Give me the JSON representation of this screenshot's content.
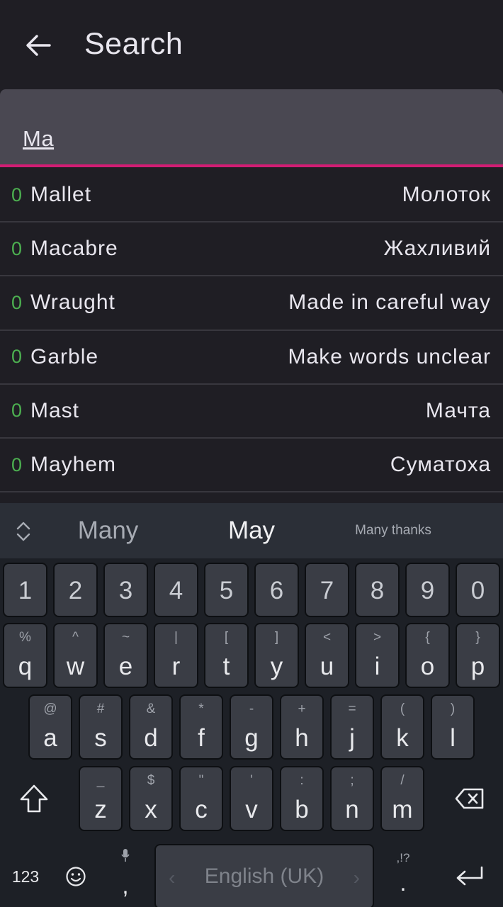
{
  "appbar": {
    "title": "Search"
  },
  "search": {
    "value": "Ma"
  },
  "list": [
    {
      "count": "0",
      "term": "Mallet",
      "translation": "Молоток"
    },
    {
      "count": "0",
      "term": "Macabre",
      "translation": "Жахливий"
    },
    {
      "count": "0",
      "term": "Wraught",
      "translation": "Made in careful way"
    },
    {
      "count": "0",
      "term": "Garble",
      "translation": "Make words unclear"
    },
    {
      "count": "0",
      "term": "Mast",
      "translation": "Мачта"
    },
    {
      "count": "0",
      "term": "Mayhem",
      "translation": "Суматоха"
    }
  ],
  "keyboard": {
    "suggestions": [
      "Many",
      "May",
      "Many thanks"
    ],
    "numbers": [
      "1",
      "2",
      "3",
      "4",
      "5",
      "6",
      "7",
      "8",
      "9",
      "0"
    ],
    "row1": [
      {
        "main": "q",
        "hint": "%"
      },
      {
        "main": "w",
        "hint": "^"
      },
      {
        "main": "e",
        "hint": "~"
      },
      {
        "main": "r",
        "hint": "|"
      },
      {
        "main": "t",
        "hint": "["
      },
      {
        "main": "y",
        "hint": "]"
      },
      {
        "main": "u",
        "hint": "<"
      },
      {
        "main": "i",
        "hint": ">"
      },
      {
        "main": "o",
        "hint": "{"
      },
      {
        "main": "p",
        "hint": "}"
      }
    ],
    "row2": [
      {
        "main": "a",
        "hint": "@"
      },
      {
        "main": "s",
        "hint": "#"
      },
      {
        "main": "d",
        "hint": "&"
      },
      {
        "main": "f",
        "hint": "*"
      },
      {
        "main": "g",
        "hint": "-"
      },
      {
        "main": "h",
        "hint": "+"
      },
      {
        "main": "j",
        "hint": "="
      },
      {
        "main": "k",
        "hint": "("
      },
      {
        "main": "l",
        "hint": ")"
      }
    ],
    "row3": [
      {
        "main": "z",
        "hint": "_"
      },
      {
        "main": "x",
        "hint": "$"
      },
      {
        "main": "c",
        "hint": "\""
      },
      {
        "main": "v",
        "hint": "'"
      },
      {
        "main": "b",
        "hint": ":"
      },
      {
        "main": "n",
        "hint": ";"
      },
      {
        "main": "m",
        "hint": "/"
      }
    ],
    "bottom": {
      "symbols_label": "123",
      "comma": ",",
      "space_label": "English (UK)",
      "period": ".",
      "period_hint": ",!?"
    }
  },
  "colors": {
    "accent": "#d21d74",
    "count": "#4caf50",
    "background": "#1f1e24"
  }
}
